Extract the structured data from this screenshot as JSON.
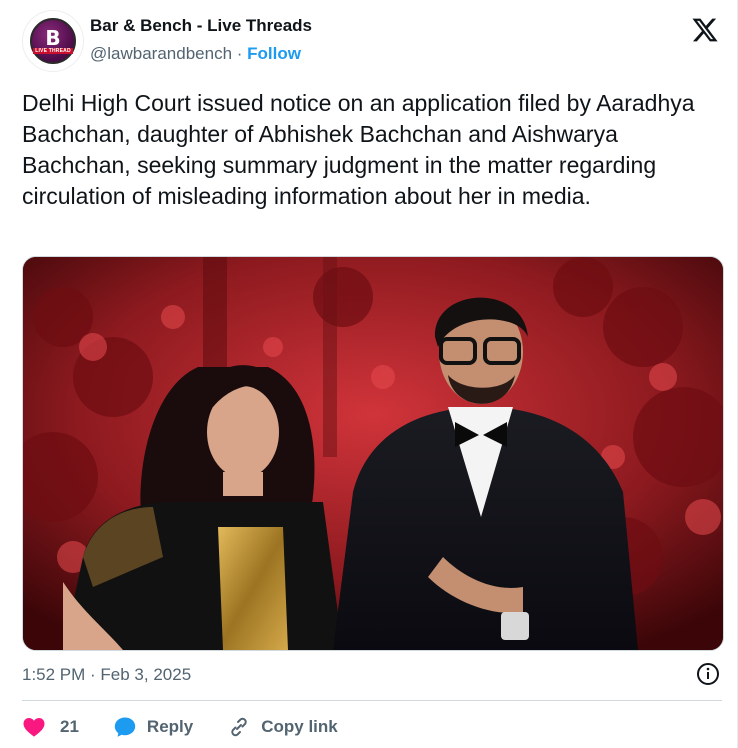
{
  "account": {
    "name": "Bar & Bench - Live Threads",
    "handle": "@lawbarandbench",
    "separator": " · ",
    "follow_label": "Follow",
    "avatar_letter": "B",
    "avatar_caption": "LIVE THREAD"
  },
  "tweet": {
    "text": "Delhi High Court issued notice on an application filed by Aaradhya Bachchan, daughter of Abhishek Bachchan and Aishwarya Bachchan, seeking summary judgment in the matter regarding circulation of misleading information about her in media.",
    "timestamp": "1:52 PM · Feb 3, 2025"
  },
  "actions": {
    "like_count": "21",
    "reply_label": "Reply",
    "copy_link_label": "Copy link"
  },
  "icons": {
    "logo": "x-logo-icon",
    "info": "info-icon",
    "like": "heart-icon",
    "reply": "speech-bubble-icon",
    "copy": "link-icon"
  },
  "colors": {
    "accent": "#1d9bf0",
    "like": "#f91880",
    "muted": "#536471",
    "text": "#0f1419"
  }
}
